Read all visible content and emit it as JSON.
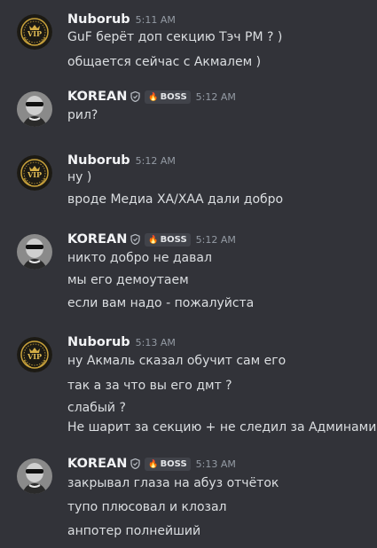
{
  "messages": [
    {
      "author": "Nuborub",
      "avatar": "vip-badge",
      "timestamp": "5:11 AM",
      "lines": [
        "GuF берёт доп секцию Тэч РМ ? )",
        "общается сейчас с Акмалем )"
      ]
    },
    {
      "author": "KOREAN",
      "avatar": "bw-photo",
      "role_tag": "BOSS",
      "timestamp": "5:12 AM",
      "lines": [
        "рил?"
      ]
    },
    {
      "author": "Nuborub",
      "avatar": "vip-badge",
      "timestamp": "5:12 AM",
      "lines": [
        "ну )",
        "вроде Медиа ХА/ХАА дали добро"
      ]
    },
    {
      "author": "KOREAN",
      "avatar": "bw-photo",
      "role_tag": "BOSS",
      "timestamp": "5:12 AM",
      "lines": [
        "никто добро не давал",
        "мы его демоутаем",
        "если вам надо - пожалуйста"
      ]
    },
    {
      "author": "Nuborub",
      "avatar": "vip-badge",
      "timestamp": "5:13 AM",
      "lines": [
        "ну Акмаль сказал обучит сам его",
        "так а за что вы его дмт ?",
        "слабый ?",
        "Не шарит за секцию + не следил за  Админами"
      ]
    },
    {
      "author": "KOREAN",
      "avatar": "bw-photo",
      "role_tag": "BOSS",
      "timestamp": "5:13 AM",
      "lines": [
        "закрывал глаза на абуз отчёток",
        "тупо плюсовал и клозал",
        "анпотер полнейший"
      ]
    }
  ],
  "colors": {
    "background": "#323339",
    "author_name": "#f2f3f5",
    "timestamp": "#949ba4",
    "text": "#dbdee1",
    "role_tag_bg": "#41434a"
  },
  "icons": {
    "verified": "shield-icon",
    "role": "fire-icon"
  }
}
